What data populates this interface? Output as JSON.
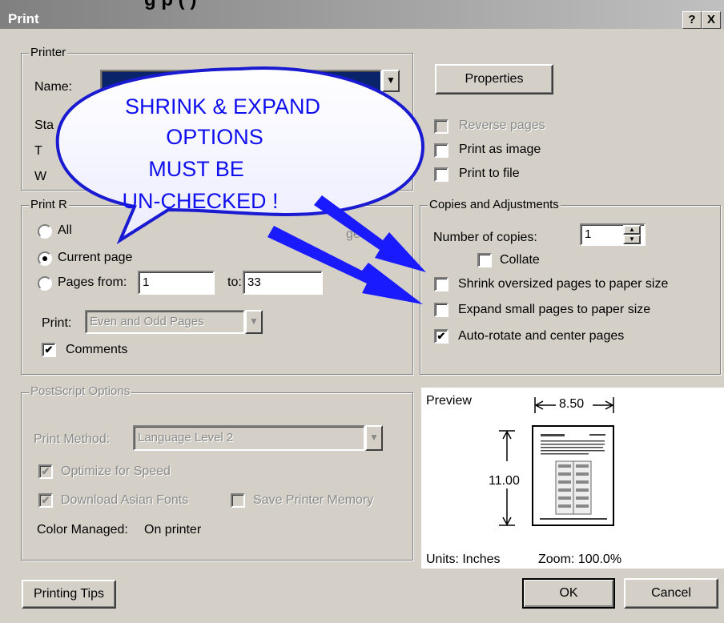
{
  "window": {
    "title": "Print",
    "help_button": "?",
    "close_button": "X",
    "cutoff_banner": "g                          p               (          )"
  },
  "printer": {
    "group_label": "Printer",
    "name_label": "Name:",
    "status_label": "Sta",
    "type_label": "T",
    "where_label": "W",
    "properties_button": "Properties",
    "reverse_pages": "Reverse pages",
    "print_as_image": "Print as image",
    "print_to_file": "Print to file"
  },
  "print_range": {
    "group_label": "Print R",
    "all_label": "All",
    "current_page_label": "Current page",
    "pages_from_label": "Pages from:",
    "pages_from_value": "1",
    "to_label": "to:",
    "to_value": "33",
    "print_label": "Print:",
    "print_select_value": "Even and Odd Pages",
    "comments_label": "Comments",
    "hidden_fragment": "ge"
  },
  "copies": {
    "group_label": "Copies and Adjustments",
    "number_label": "Number of copies:",
    "number_value": "1",
    "collate_label": "Collate",
    "shrink_label": "Shrink oversized pages to paper size",
    "expand_label": "Expand small pages to paper size",
    "autorotate_label": "Auto-rotate and center pages"
  },
  "postscript": {
    "group_label": "PostScript Options",
    "print_method_label": "Print Method:",
    "print_method_value": "Language Level 2",
    "optimize_label": "Optimize for Speed",
    "download_fonts_label": "Download Asian Fonts",
    "save_memory_label": "Save Printer Memory",
    "color_managed_label": "Color Managed:",
    "color_managed_value": "On printer"
  },
  "preview": {
    "label": "Preview",
    "width_dim": "8.50",
    "height_dim": "11.00",
    "units": "Units: Inches",
    "zoom": "Zoom: 100.0%"
  },
  "callout": {
    "line1": "SHRINK & EXPAND",
    "line2": "OPTIONS",
    "line3": "MUST BE",
    "line4": "UN-CHECKED !"
  },
  "buttons": {
    "printing_tips": "Printing Tips",
    "ok": "OK",
    "cancel": "Cancel"
  },
  "colors": {
    "callout_text": "#1010ee",
    "arrow": "#1a1aff",
    "title_bar": "#808080"
  }
}
